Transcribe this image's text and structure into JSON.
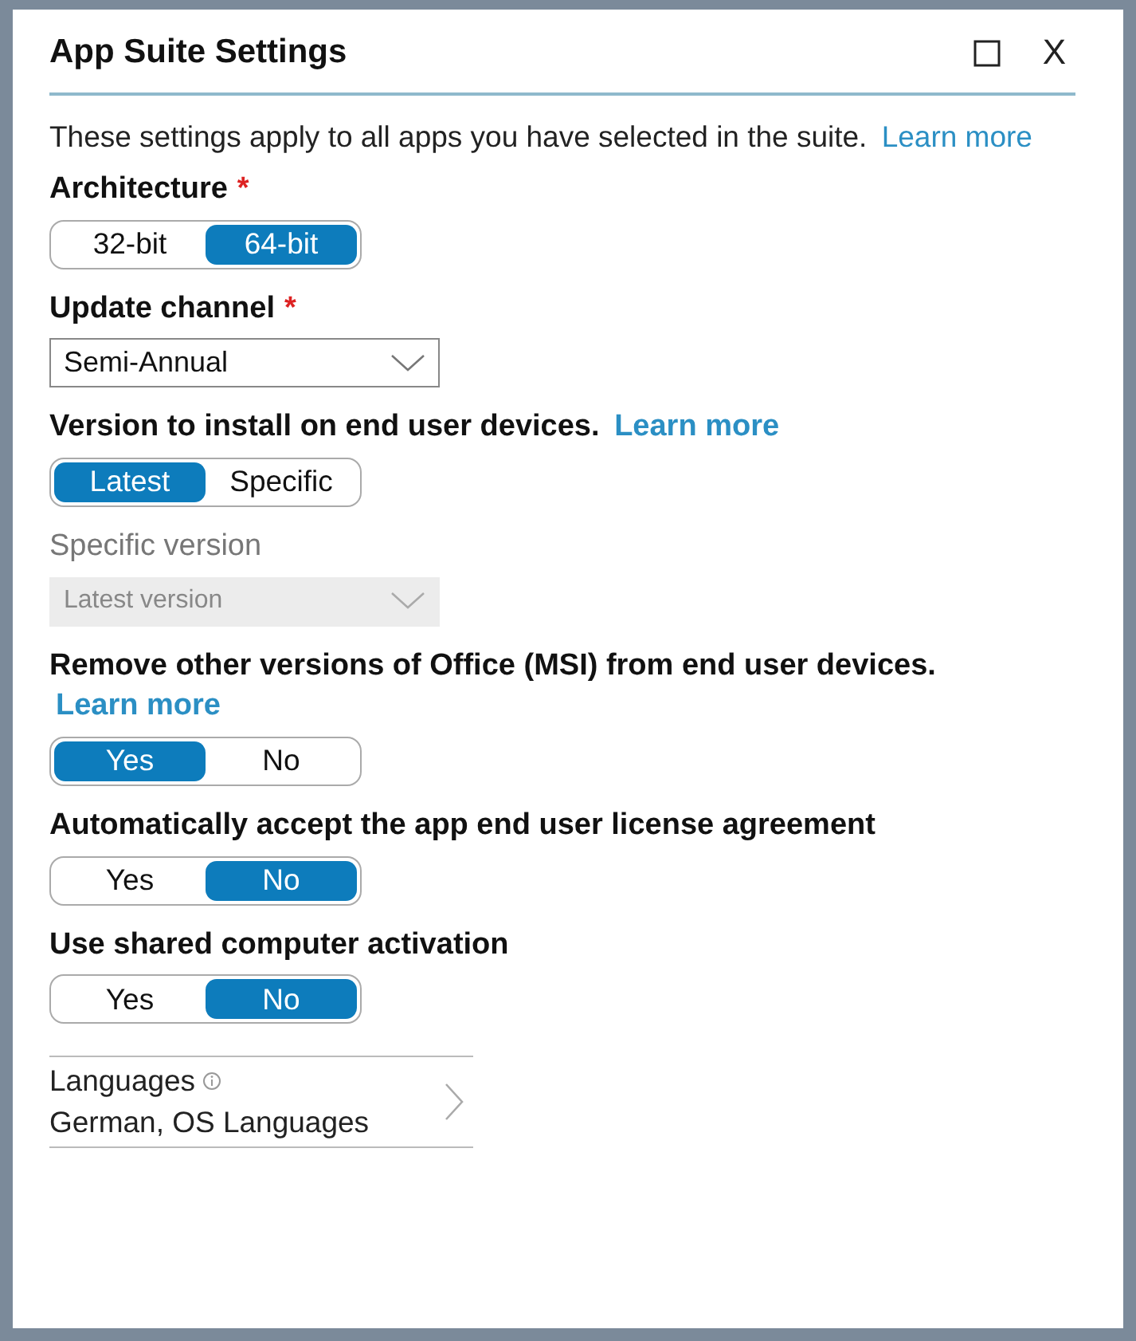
{
  "window": {
    "title": "App Suite Settings",
    "close_label": "X"
  },
  "intro": {
    "text": "These settings apply to all apps you have selected in the suite.",
    "link": "Learn more"
  },
  "sections": [
    {
      "kind": "toggle",
      "label": "Architecture",
      "required_mark": "*",
      "options": [
        {
          "label": "32-bit",
          "selected": false
        },
        {
          "label": "64-bit",
          "selected": true
        }
      ]
    },
    {
      "kind": "dropdown",
      "label": "Update channel",
      "required_mark": "*",
      "value": "Semi-Annual",
      "disabled": false
    },
    {
      "kind": "toggle",
      "label": "Version to install on end user devices.",
      "link": "Learn more",
      "options": [
        {
          "label": "Latest",
          "selected": true
        },
        {
          "label": "Specific",
          "selected": false
        }
      ]
    },
    {
      "kind": "dropdown",
      "label": "Specific version",
      "value": "Latest version",
      "disabled": true
    },
    {
      "kind": "toggle",
      "label": "Remove other versions of Office (MSI) from end user devices.",
      "link": "Learn more",
      "options": [
        {
          "label": "Yes",
          "selected": true
        },
        {
          "label": "No",
          "selected": false
        }
      ]
    },
    {
      "kind": "toggle",
      "label": "Automatically accept the app end user license agreement",
      "options": [
        {
          "label": "Yes",
          "selected": false
        },
        {
          "label": "No",
          "selected": true
        }
      ]
    },
    {
      "kind": "toggle",
      "label": "Use shared computer activation",
      "options": [
        {
          "label": "Yes",
          "selected": false
        },
        {
          "label": "No",
          "selected": true
        }
      ]
    }
  ],
  "languages": {
    "label": "Languages",
    "value": "German, OS Languages"
  }
}
